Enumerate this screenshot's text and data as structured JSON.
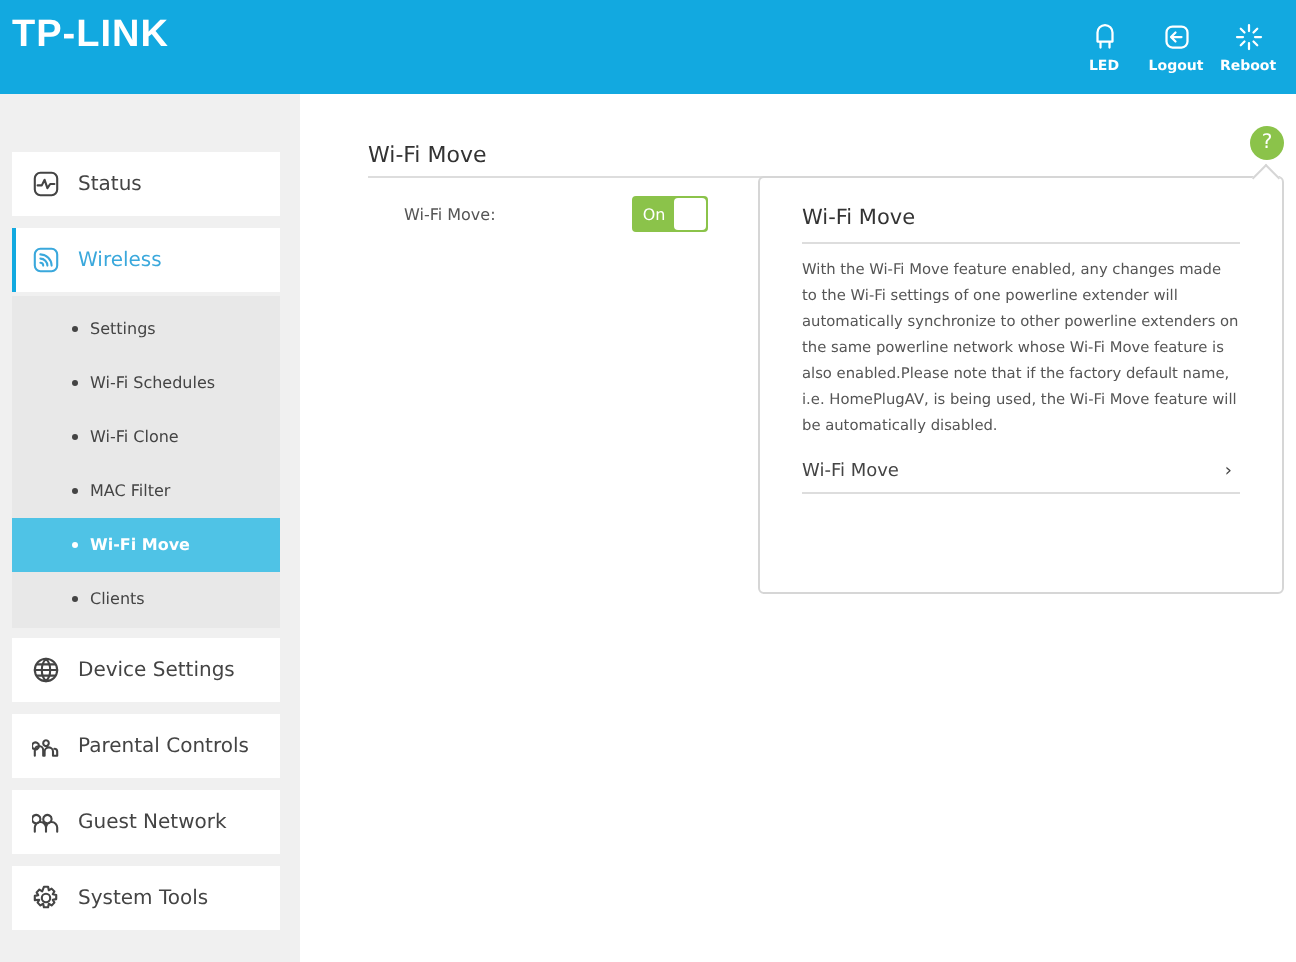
{
  "header": {
    "logo": "TP-LINK",
    "actions": [
      {
        "kind": "led",
        "label": "LED"
      },
      {
        "kind": "logout",
        "label": "Logout"
      },
      {
        "kind": "reboot",
        "label": "Reboot"
      }
    ]
  },
  "sidebar": {
    "items": [
      {
        "kind": "status",
        "label": "Status",
        "selected": false
      },
      {
        "kind": "wireless",
        "label": "Wireless",
        "selected": true,
        "expanded": true,
        "children": [
          {
            "label": "Settings",
            "selected": false
          },
          {
            "label": "Wi-Fi Schedules",
            "selected": false
          },
          {
            "label": "Wi-Fi Clone",
            "selected": false
          },
          {
            "label": "MAC Filter",
            "selected": false
          },
          {
            "label": "Wi-Fi Move",
            "selected": true
          },
          {
            "label": "Clients",
            "selected": false
          }
        ]
      },
      {
        "kind": "device",
        "label": "Device Settings",
        "selected": false
      },
      {
        "kind": "parental",
        "label": "Parental Controls",
        "selected": false
      },
      {
        "kind": "guest",
        "label": "Guest Network",
        "selected": false
      },
      {
        "kind": "tools",
        "label": "System Tools",
        "selected": false
      }
    ]
  },
  "main": {
    "title": "Wi-Fi Move",
    "setting": {
      "label": "Wi-Fi Move:",
      "toggle_label": "On",
      "on": true
    },
    "help_button": "?"
  },
  "help_popup": {
    "title": "Wi-Fi Move",
    "text": "With the Wi-Fi Move feature enabled, any changes made to the Wi-Fi settings of one powerline extender will automatically synchronize to other powerline extenders on the same powerline network whose Wi-Fi Move feature is also enabled.Please note that if the factory default name, i.e. HomePlugAV, is being used, the Wi-Fi Move feature will be automatically disabled.",
    "links": [
      {
        "label": "Wi-Fi Move",
        "arrow": "›"
      }
    ]
  }
}
